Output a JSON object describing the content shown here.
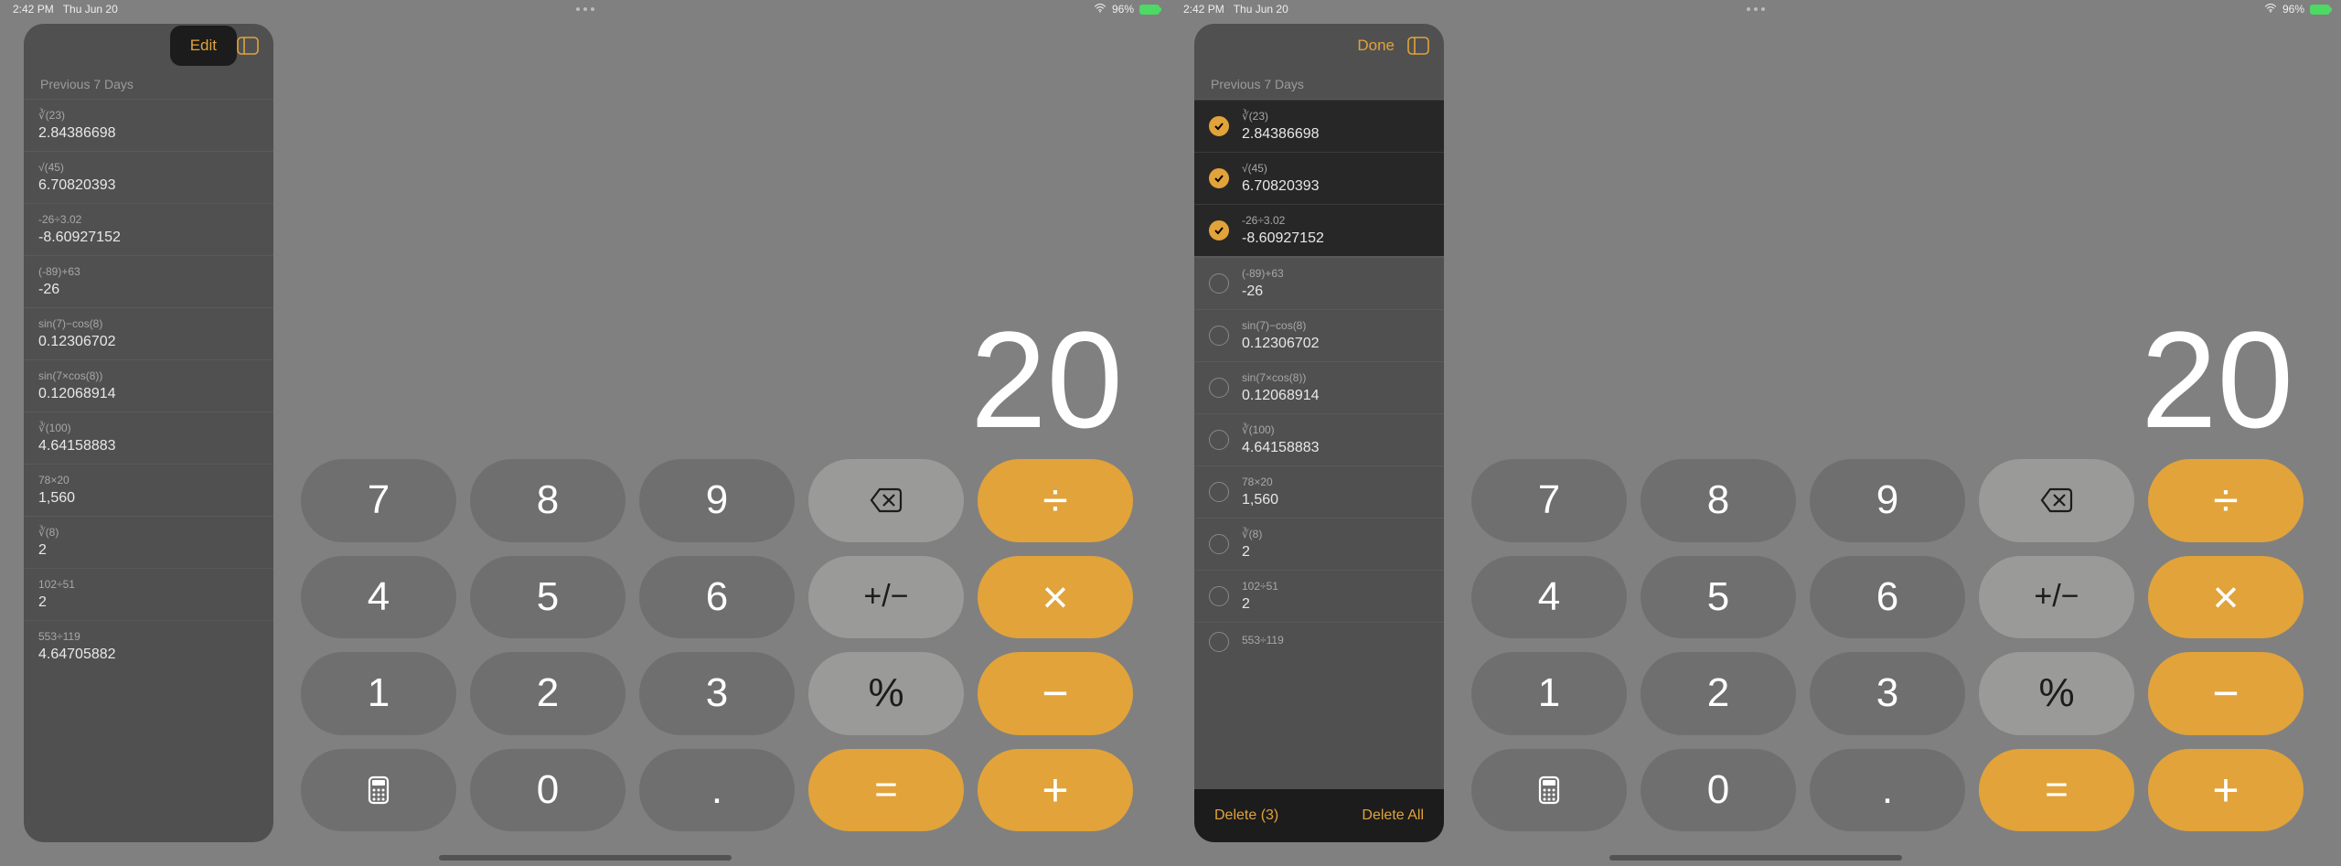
{
  "status": {
    "time": "2:42 PM",
    "date": "Thu Jun 20",
    "battery_pct": "96%"
  },
  "left": {
    "action_label": "Edit",
    "section_label": "Previous 7 Days",
    "display_value": "20",
    "history": [
      {
        "expr": "∛(23)",
        "result": "2.84386698"
      },
      {
        "expr": "√(45)",
        "result": "6.70820393"
      },
      {
        "expr": "-26÷3.02",
        "result": "-8.60927152"
      },
      {
        "expr": "(-89)+63",
        "result": "-26"
      },
      {
        "expr": "sin(7)−cos(8)",
        "result": "0.12306702"
      },
      {
        "expr": "sin(7×cos(8))",
        "result": "0.12068914"
      },
      {
        "expr": "∛(100)",
        "result": "4.64158883"
      },
      {
        "expr": "78×20",
        "result": "1,560"
      },
      {
        "expr": "∛(8)",
        "result": "2"
      },
      {
        "expr": "102÷51",
        "result": "2"
      },
      {
        "expr": "553÷119",
        "result": "4.64705882"
      }
    ]
  },
  "right": {
    "action_label": "Done",
    "section_label": "Previous 7 Days",
    "display_value": "20",
    "delete_selected_label": "Delete (3)",
    "delete_all_label": "Delete All",
    "history": [
      {
        "expr": "∛(23)",
        "result": "2.84386698",
        "checked": true
      },
      {
        "expr": "√(45)",
        "result": "6.70820393",
        "checked": true
      },
      {
        "expr": "-26÷3.02",
        "result": "-8.60927152",
        "checked": true
      },
      {
        "expr": "(-89)+63",
        "result": "-26",
        "checked": false
      },
      {
        "expr": "sin(7)−cos(8)",
        "result": "0.12306702",
        "checked": false
      },
      {
        "expr": "sin(7×cos(8))",
        "result": "0.12068914",
        "checked": false
      },
      {
        "expr": "∛(100)",
        "result": "4.64158883",
        "checked": false
      },
      {
        "expr": "78×20",
        "result": "1,560",
        "checked": false
      },
      {
        "expr": "∛(8)",
        "result": "2",
        "checked": false
      },
      {
        "expr": "102÷51",
        "result": "2",
        "checked": false
      },
      {
        "expr": "553÷119",
        "result": "",
        "checked": false
      }
    ]
  },
  "keys": {
    "seven": "7",
    "eight": "8",
    "nine": "9",
    "four": "4",
    "five": "5",
    "six": "6",
    "one": "1",
    "two": "2",
    "three": "3",
    "zero": "0",
    "dot": ".",
    "divide": "÷",
    "multiply": "×",
    "minus": "−",
    "plus": "+",
    "equals": "=",
    "percent": "%",
    "plusminus": "+/−"
  }
}
